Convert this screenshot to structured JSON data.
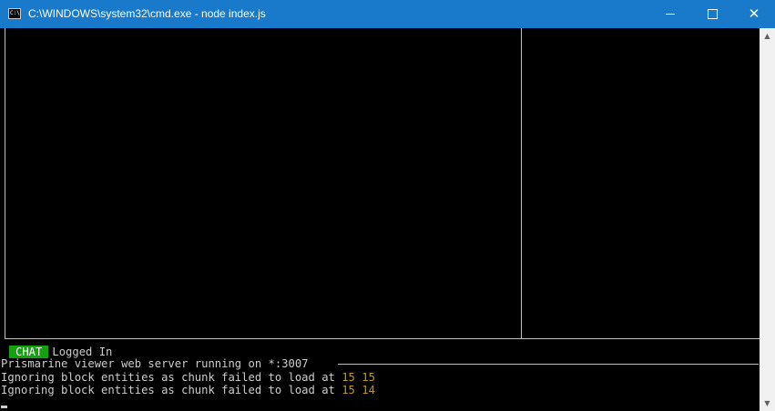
{
  "window": {
    "title": "C:\\WINDOWS\\system32\\cmd.exe - node  index.js",
    "icon": "cmd-icon",
    "icon_text": "C:\\",
    "minimize_glyph": "",
    "close_glyph": "✕",
    "titlebar_color": "#1979ca"
  },
  "console": {
    "chat_label": "CHAT",
    "chat_status": "Logged In",
    "chat_color": "#13a10e",
    "lines": [
      {
        "text": "Prismarine viewer web server running on *:3007"
      },
      {
        "prefix": "Ignoring block entities as chunk failed to load at ",
        "x": "15",
        "z": "15"
      },
      {
        "prefix": "Ignoring block entities as chunk failed to load at ",
        "x": "15",
        "z": "14"
      }
    ],
    "number_color": "#c19c00"
  },
  "scrollbar": {
    "up_glyph": "▲",
    "down_glyph": "▼"
  }
}
